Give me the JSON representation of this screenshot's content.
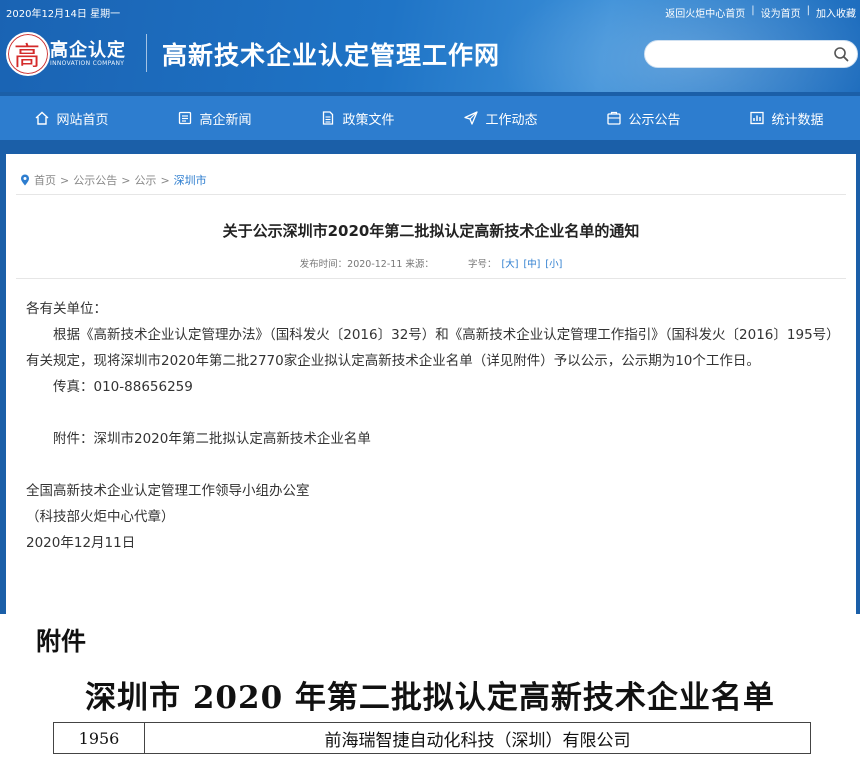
{
  "topbar": {
    "date": "2020年12月14日 星期一",
    "links": [
      "返回火炬中心首页",
      "设为首页",
      "加入收藏"
    ],
    "separator": "|"
  },
  "logo": {
    "mark": "高",
    "text": "高企认定",
    "subtext": "INNOVATION COMPANY"
  },
  "site_title": "高新技术企业认定管理工作网",
  "search": {
    "placeholder": "",
    "icon": "search-icon"
  },
  "nav": [
    {
      "label": "网站首页",
      "icon": "home-icon"
    },
    {
      "label": "高企新闻",
      "icon": "news-icon"
    },
    {
      "label": "政策文件",
      "icon": "document-icon"
    },
    {
      "label": "工作动态",
      "icon": "send-icon"
    },
    {
      "label": "公示公告",
      "icon": "notice-icon"
    },
    {
      "label": "统计数据",
      "icon": "chart-icon"
    }
  ],
  "breadcrumb": {
    "items": [
      "首页",
      "公示公告",
      "公示"
    ],
    "separator": ">",
    "current": "深圳市"
  },
  "article": {
    "title": "关于公示深圳市2020年第二批拟认定高新技术企业名单的通知",
    "publish_time": "发布时间：2020-12-11 来源：",
    "font_size_label": "字号：",
    "font_sizes": [
      "[大]",
      "[中]",
      "[小]"
    ],
    "salutation": "各有关单位：",
    "paragraph": "根据《高新技术企业认定管理办法》（国科发火〔2016〕32号）和《高新技术企业认定管理工作指引》（国科发火〔2016〕195号）有关规定，现将深圳市2020年第二批2770家企业拟认定高新技术企业名单（详见附件）予以公示，公示期为10个工作日。",
    "fax": "传真：010-88656259",
    "attachment_line": "附件：深圳市2020年第二批拟认定高新技术企业名单",
    "signature_org": "全国高新技术企业认定管理工作领导小组办公室",
    "signature_note": "（科技部火炬中心代章）",
    "signature_date": "2020年12月11日"
  },
  "attachment": {
    "label": "附件",
    "title": "深圳市 2020 年第二批拟认定高新技术企业名单",
    "rows": [
      {
        "num": "1956",
        "name": "前海瑞智捷自动化科技（深圳）有限公司"
      }
    ]
  },
  "colors": {
    "header_blue": "#1a63b3",
    "nav_blue": "#2d7dcf",
    "link_blue": "#2d7dcf"
  }
}
